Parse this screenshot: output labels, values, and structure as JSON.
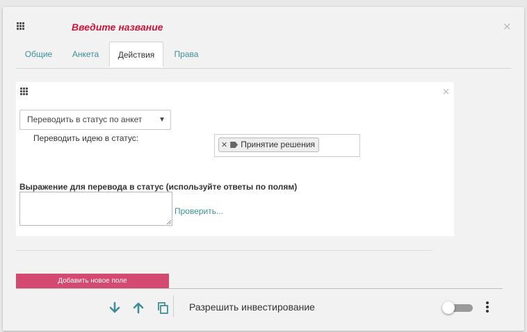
{
  "header": {
    "title": "Введите название"
  },
  "tabs": [
    {
      "label": "Общие",
      "active": false
    },
    {
      "label": "Анкета",
      "active": false
    },
    {
      "label": "Действия",
      "active": true
    },
    {
      "label": "Права",
      "active": false
    }
  ],
  "action": {
    "select_value": "Переводить в статус по анкет",
    "status_label": "Переводить идею в статус:",
    "status_tag": "Принятие решения",
    "expression_label": "Выражение для перевода в статус (используйте ответы по полям)",
    "expression_value": "",
    "check_link": "Проверить..."
  },
  "footer": {
    "add_field_button": "Добавить новое поле",
    "allow_investing_label": "Разрешить инвестирование",
    "allow_investing_enabled": false
  },
  "icons": {
    "grip": "grip-icon",
    "close": "close-icon",
    "move_down": "arrow-down-icon",
    "move_up": "arrow-up-icon",
    "copy": "copy-icon",
    "tag": "tag-icon",
    "more": "more-vert-icon"
  },
  "colors": {
    "title": "#c8153c",
    "accent": "#3e8e98",
    "add_button": "#d4496f"
  }
}
